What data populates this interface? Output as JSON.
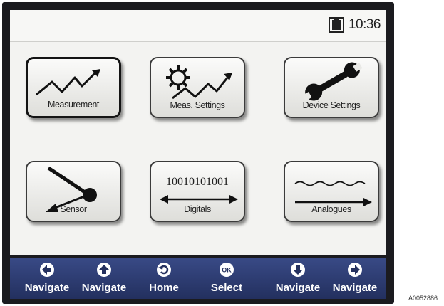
{
  "status": {
    "time": "10:36",
    "icon": "battery-status-icon"
  },
  "tiles": [
    {
      "label": "Measurement",
      "icon": "trend-line-icon",
      "selected": true
    },
    {
      "label": "Meas. Settings",
      "icon": "gear-trend-icon"
    },
    {
      "label": "Device Settings",
      "icon": "wrench-icon"
    },
    {
      "label": "Sensor",
      "icon": "sensor-pointer-icon"
    },
    {
      "label": "Digitals",
      "icon": "bidirectional-arrow-icon",
      "bits": "10010101001"
    },
    {
      "label": "Analogues",
      "icon": "wave-arrow-icon"
    }
  ],
  "navbar": [
    {
      "label": "Navigate",
      "icon": "arrow-left-circle-icon"
    },
    {
      "label": "Navigate",
      "icon": "arrow-up-circle-icon"
    },
    {
      "label": "Home",
      "icon": "home-circle-icon"
    },
    {
      "label": "Select",
      "icon": "ok-circle-icon",
      "glyph": "OK"
    },
    {
      "label": "Navigate",
      "icon": "arrow-down-circle-icon"
    },
    {
      "label": "Navigate",
      "icon": "arrow-right-circle-icon"
    }
  ],
  "figure_ref": "A0052886"
}
